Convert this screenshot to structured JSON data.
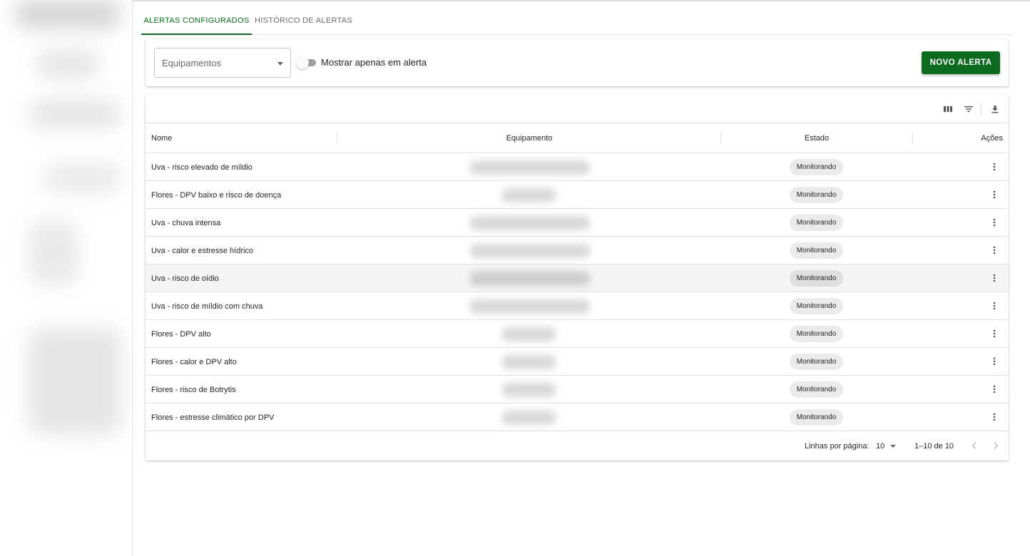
{
  "tabs": [
    {
      "label": "ALERTAS CONFIGURADOS",
      "active": true
    },
    {
      "label": "HISTÓRICO DE ALERTAS",
      "active": false
    }
  ],
  "filters": {
    "equipment_placeholder": "Equipamentos",
    "toggle_label": "Mostrar apenas em alerta",
    "toggle_on": false,
    "new_alert_label": "NOVO ALERTA"
  },
  "toolbar": {
    "icons": [
      "view-columns-icon",
      "filter-icon",
      "download-icon"
    ]
  },
  "table": {
    "columns": [
      "Nome",
      "Equipamento",
      "Estado",
      "Ações"
    ],
    "rows": [
      {
        "name": "Uva - risco elevado de míldio",
        "status": "Monitorando"
      },
      {
        "name": "Flores - DPV baixo e risco de doença",
        "status": "Monitorando"
      },
      {
        "name": "Uva - chuva intensa",
        "status": "Monitorando"
      },
      {
        "name": "Uva - calor e estresse hídrico",
        "status": "Monitorando"
      },
      {
        "name": "Uva - risco de oídio",
        "status": "Monitorando"
      },
      {
        "name": "Uva - risco de míldio com chuva",
        "status": "Monitorando"
      },
      {
        "name": "Flores - DPV alto",
        "status": "Monitorando"
      },
      {
        "name": "Flores - calor e DPV alto",
        "status": "Monitorando"
      },
      {
        "name": "Flores - risco de Botrytis",
        "status": "Monitorando"
      },
      {
        "name": "Flores - estresse climático por DPV",
        "status": "Monitorando"
      }
    ]
  },
  "pagination": {
    "rows_per_page_label": "Linhas por página:",
    "rows_per_page": "10",
    "range": "1–10 de 10"
  },
  "colors": {
    "accent": "#0d6b1f",
    "chip": "#ebebeb",
    "row_hover": "#f5f5f5"
  }
}
